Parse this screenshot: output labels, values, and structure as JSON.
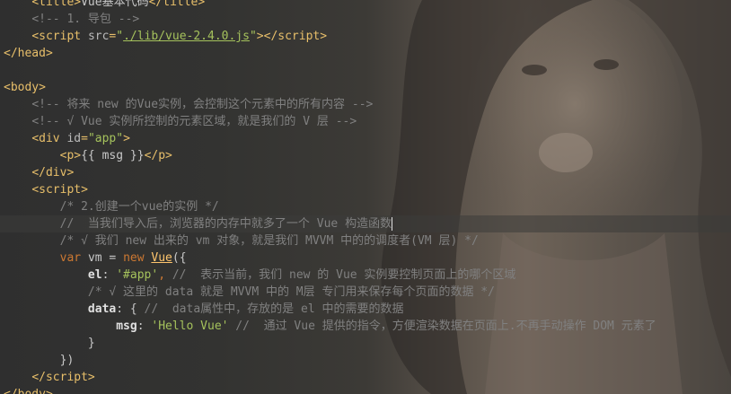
{
  "code": {
    "title_partial": "Vue基本代码",
    "comment_import": "<!-- 1. 导包 -->",
    "script_src": "./lib/vue-2.4.0.js",
    "comment_instance": "<!-- 将来 new 的Vue实例，会控制这个元素中的所有内容 -->",
    "comment_v_layer": "<!-- √ Vue 实例所控制的元素区域，就是我们的 V 层 -->",
    "div_id": "\"app\"",
    "template_expr": "{{ msg }}",
    "comment_create": "/* 2.创建一个vue的实例 */",
    "comment_constructor": "//  当我们导入后，浏览器的内存中就多了一个 Vue 构造函数",
    "comment_vm": "/* √ 我们 new 出来的 vm 对象，就是我们 MVVM 中的的调度者(VM 层) */",
    "vm_keyword": "var",
    "vm_name": "vm",
    "new_keyword": "new",
    "constructor_name": "Vue",
    "el_key": "el",
    "el_value": "'#app'",
    "comment_el": "//  表示当前，我们 new 的 Vue 实例要控制页面上的哪个区域",
    "comment_data_m": "/* √ 这里的 data 就是 MVVM 中的 M层 专门用来保存每个页面的数据 */",
    "data_key": "data",
    "comment_data_attr": "//  data属性中，存放的是 el 中的需要的数据",
    "msg_key": "msg",
    "msg_value": "'Hello Vue'",
    "comment_msg": "//  通过 Vue 提供的指令，方便渲染数据在页面上.不再手动操作 DOM 元素了"
  }
}
